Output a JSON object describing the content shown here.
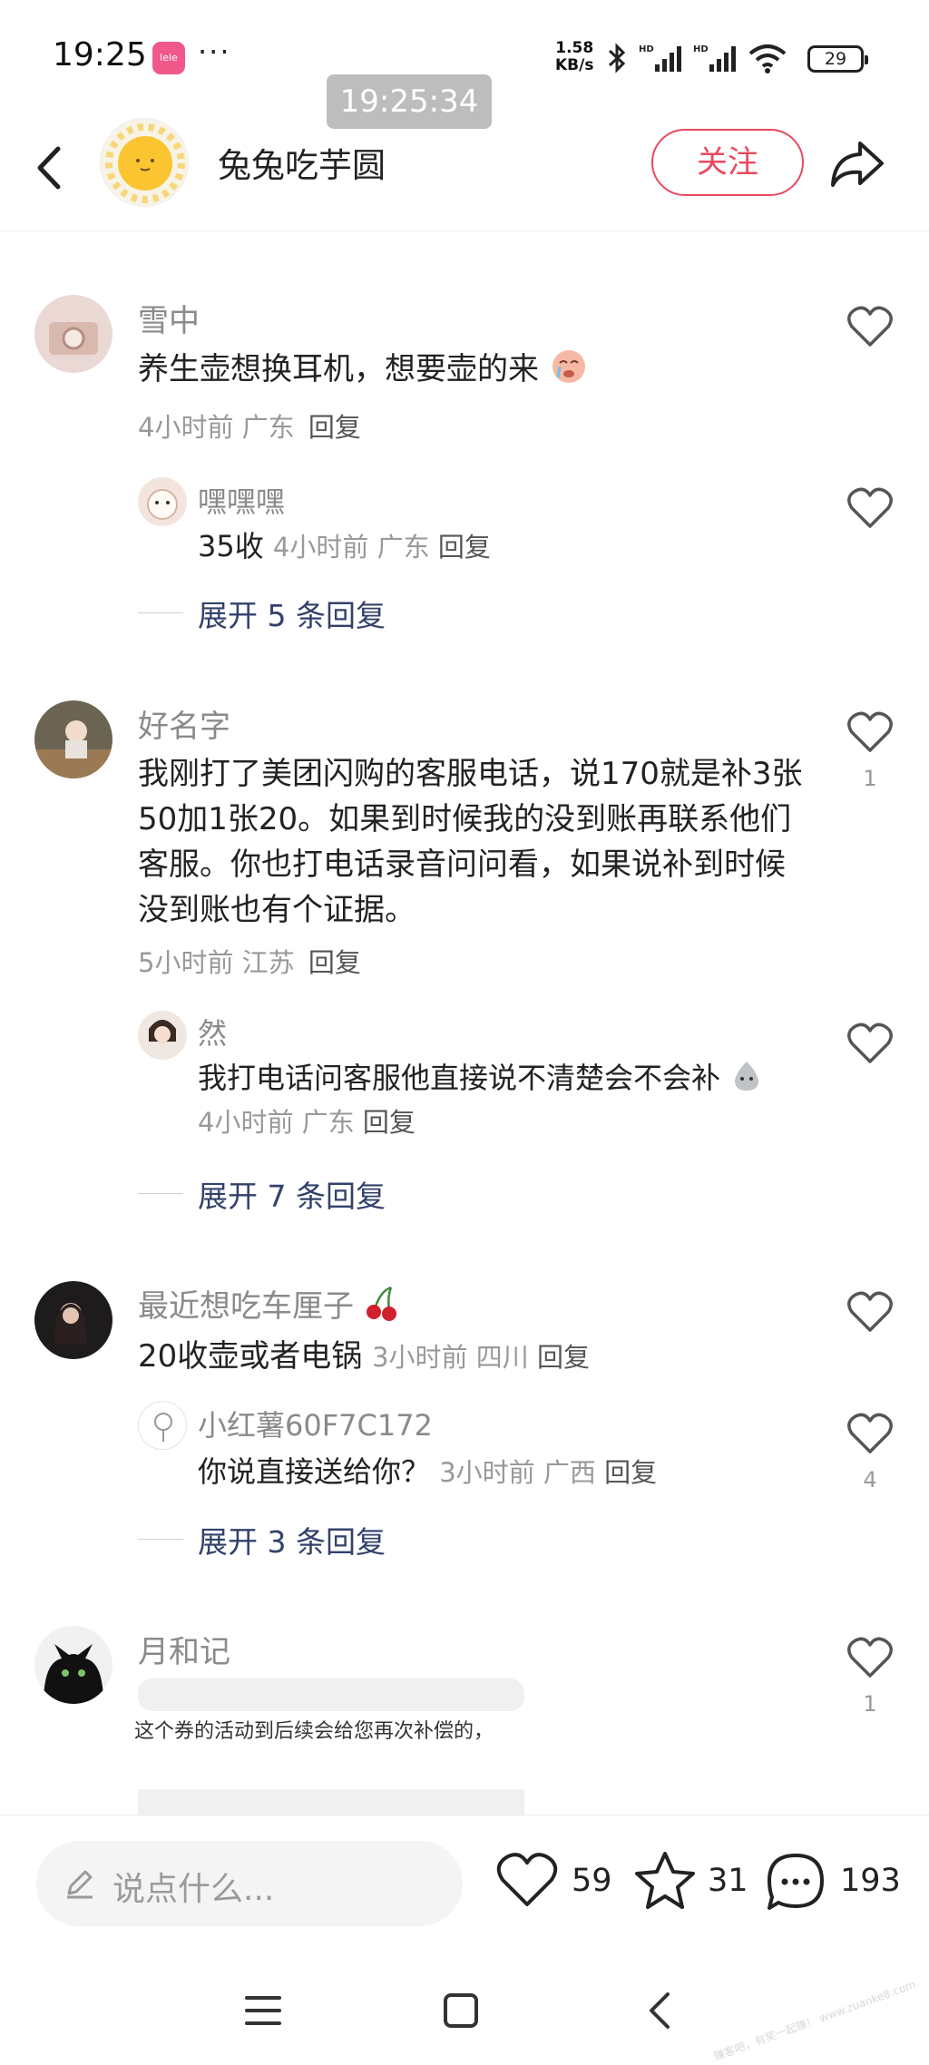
{
  "status_bar": {
    "time": "19:25",
    "app_icon_label": "lele",
    "more": "···",
    "net_speed_value": "1.58",
    "net_speed_unit": "KB/s",
    "battery": "29",
    "screenshot_time": "19:25:34"
  },
  "header": {
    "author": "兔兔吃芋圆",
    "follow_label": "关注"
  },
  "comments": [
    {
      "name": "雪中",
      "text": "养生壶想换耳机，想要壶的来",
      "time": "4小时前",
      "location": "广东",
      "reply_label": "回复",
      "likes": "",
      "replies": [
        {
          "name": "嘿嘿嘿",
          "text": "35收",
          "time": "4小时前",
          "location": "广东",
          "reply_label": "回复"
        }
      ],
      "expand_label": "展开 5 条回复"
    },
    {
      "name": "好名字",
      "text": "我刚打了美团闪购的客服电话，说170就是补3张50加1张20。如果到时候我的没到账再联系他们客服。你也打电话录音问问看，如果说补到时候没到账也有个证据。",
      "time": "5小时前",
      "location": "江苏",
      "reply_label": "回复",
      "likes": "1",
      "replies": [
        {
          "name": "然",
          "text": "我打电话问客服他直接说不清楚会不会补",
          "time": "4小时前",
          "location": "广东",
          "reply_label": "回复"
        }
      ],
      "expand_label": "展开 7 条回复"
    },
    {
      "name": "最近想吃车厘子",
      "text": "20收壶或者电锅",
      "time": "3小时前",
      "location": "四川",
      "reply_label": "回复",
      "likes": "",
      "replies": [
        {
          "name": "小红薯60F7C172",
          "text": "你说直接送给你？",
          "time": "3小时前",
          "location": "广西",
          "reply_label": "回复",
          "likes": "4"
        }
      ],
      "expand_label": "展开 3 条回复"
    },
    {
      "name": "月和记",
      "image_caption": "这个券的活动到后续会给您再次补偿的，",
      "likes": "1"
    }
  ],
  "bottom_bar": {
    "placeholder": "说点什么...",
    "likes": "59",
    "favorites": "31",
    "comments": "193"
  },
  "watermark": "赚客吧，有奖一起赚！ www.zuanke8.com"
}
